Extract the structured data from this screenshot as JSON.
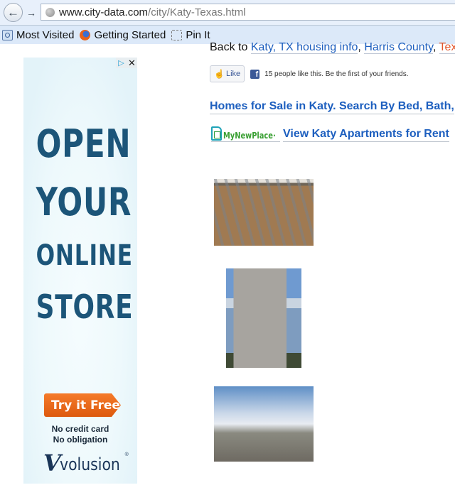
{
  "browser": {
    "url_host": "www.city-data.com",
    "url_path": "/city/Katy-Texas.html",
    "back_icon": "back-arrow-icon",
    "forward_icon": "forward-arrow-icon",
    "bookmarks": [
      {
        "label": "Most Visited",
        "icon": "most-visited-icon"
      },
      {
        "label": "Getting Started",
        "icon": "firefox-icon"
      },
      {
        "label": "Pin It",
        "icon": "pin-it-icon"
      }
    ]
  },
  "ad": {
    "choices_glyph": "▷",
    "close_glyph": "✕",
    "headline": [
      "OPEN",
      "YOUR",
      "ONLINE",
      "STORE"
    ],
    "cta": "Try it Free",
    "notes": [
      "No credit card",
      "No obligation"
    ],
    "brand": "volusion",
    "brand_mark": "V",
    "brand_reg": "®",
    "colors": {
      "headline": "#1c5579",
      "cta": "#f57b2a"
    }
  },
  "content": {
    "back_to_prefix": "Back to ",
    "back_links": [
      {
        "label": "Katy, TX housing info"
      },
      {
        "label": "Harris County"
      },
      {
        "label": "Texas"
      }
    ],
    "separators": [
      ", ",
      ", "
    ],
    "fb": {
      "like_label": "Like",
      "thumb_glyph": "👍",
      "f_glyph": "f",
      "text": "15 people like this. Be the first of your friends."
    },
    "homes_link": "Homes for Sale in Katy. Search By Bed, Bath,",
    "mnp_logo": "MyNewPlace",
    "mnp_tm": "·",
    "apartments_link": "View Katy Apartments for Rent",
    "photos": [
      {
        "alt": "terracotta-army-photo"
      },
      {
        "alt": "grain-elevator-photo"
      },
      {
        "alt": "railroad-tracks-photo"
      }
    ],
    "link_color": "#1d5fbf"
  }
}
